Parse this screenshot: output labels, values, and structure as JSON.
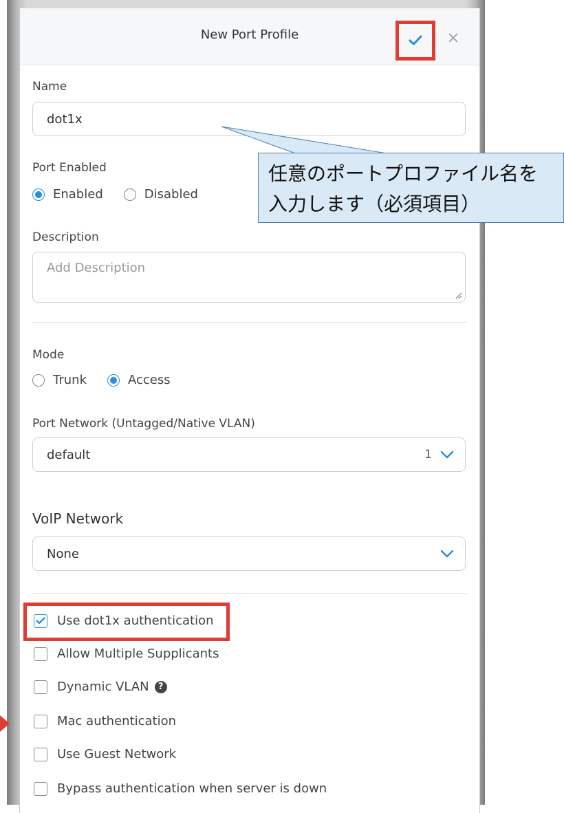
{
  "header": {
    "title": "New Port Profile"
  },
  "name": {
    "label": "Name",
    "value": "dot1x"
  },
  "port_enabled": {
    "label": "Port Enabled",
    "options": [
      "Enabled",
      "Disabled"
    ],
    "selected": "Enabled"
  },
  "description": {
    "label": "Description",
    "placeholder": "Add Description"
  },
  "mode": {
    "label": "Mode",
    "options": [
      "Trunk",
      "Access"
    ],
    "selected": "Access"
  },
  "port_network": {
    "label": "Port Network (Untagged/Native VLAN)",
    "value": "default",
    "vlan_id": "1"
  },
  "voip": {
    "label": "VoIP Network",
    "value": "None"
  },
  "checkboxes": [
    {
      "label": "Use dot1x authentication",
      "checked": true
    },
    {
      "label": "Allow Multiple Supplicants",
      "checked": false
    },
    {
      "label": "Dynamic VLAN",
      "checked": false
    },
    {
      "label": "Mac authentication",
      "checked": false
    },
    {
      "label": "Use Guest Network",
      "checked": false
    },
    {
      "label": "Bypass authentication when server is down",
      "checked": false
    }
  ],
  "callout": {
    "line1": "任意のポートプロファイル名を",
    "line2": "入力します（必須項目）"
  },
  "colors": {
    "accent": "#2a8fdc",
    "highlight": "#e03c32",
    "callout_bg": "#d9eaf6"
  }
}
